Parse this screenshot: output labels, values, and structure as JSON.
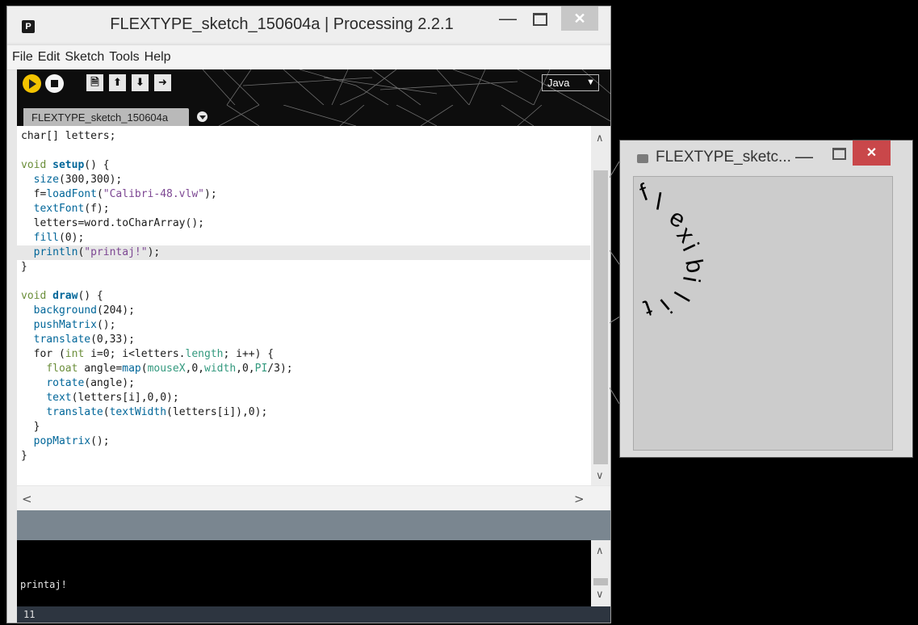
{
  "ide": {
    "app_icon": "P",
    "title": "FLEXTYPE_sketch_150604a | Processing 2.2.1",
    "controls": {
      "minimize": "—",
      "close": "✕"
    },
    "menu": [
      "File",
      "Edit",
      "Sketch",
      "Tools",
      "Help"
    ],
    "toolbar": {
      "run_icon": "play-icon",
      "stop_icon": "stop-icon",
      "new_glyph": "🗎",
      "open_glyph": "⬆",
      "save_glyph": "⬇",
      "export_glyph": "➜",
      "mode": "Java",
      "mode_arrow": "▼"
    },
    "tab_label": "FLEXTYPE_sketch_150604a",
    "code": {
      "l1": "char[] letters;",
      "l3_kw": "void",
      "l3_fn": "setup",
      "l3_rest": "() {",
      "l4_fn": "size",
      "l4_rest": "(300,300);",
      "l5_a": "f=",
      "l5_fn": "loadFont",
      "l5_b": "(",
      "l5_str": "\"Calibri-48.vlw\"",
      "l5_c": ");",
      "l6_fn": "textFont",
      "l6_rest": "(f);",
      "l7": "letters=word.toCharArray();",
      "l8_fn": "fill",
      "l8_rest": "(0);",
      "l9_fn": "println",
      "l9_b": "(",
      "l9_str": "\"printaj!\"",
      "l9_c": ");",
      "l10": "}",
      "l12_kw": "void",
      "l12_fn": "draw",
      "l12_rest": "() {",
      "l13_fn": "background",
      "l13_rest": "(204);",
      "l14_fn": "pushMatrix",
      "l14_rest": "();",
      "l15_fn": "translate",
      "l15_rest": "(0,33);",
      "l16_a": "for (",
      "l16_kw": "int",
      "l16_b": " i=0; i<letters.",
      "l16_con": "length",
      "l16_c": "; i++) {",
      "l17_kw": "float",
      "l17_a": " angle=",
      "l17_fn": "map",
      "l17_b": "(",
      "l17_mx": "mouseX",
      "l17_c": ",0,",
      "l17_w": "width",
      "l17_d": ",0,",
      "l17_pi": "PI",
      "l17_e": "/3);",
      "l18_fn": "rotate",
      "l18_rest": "(angle);",
      "l19_fn": "text",
      "l19_rest": "(letters[i],0,0);",
      "l20_fn": "translate",
      "l20_a": "(",
      "l20_fn2": "textWidth",
      "l20_b": "(letters[i]),0);",
      "l21": "}",
      "l22_fn": "popMatrix",
      "l22_rest": "();",
      "l23": "}"
    },
    "scroll": {
      "up": "∧",
      "down": "∨",
      "left": "<",
      "right": ">"
    },
    "console_output": "printaj!",
    "status_line": "11"
  },
  "sketch_window": {
    "title": "FLEXTYPE_sketc...",
    "controls": {
      "minimize": "—",
      "close": "✕"
    },
    "letters": [
      "f",
      "l",
      "e",
      "x",
      "i",
      "b",
      "i",
      "l",
      "i",
      "t"
    ]
  }
}
